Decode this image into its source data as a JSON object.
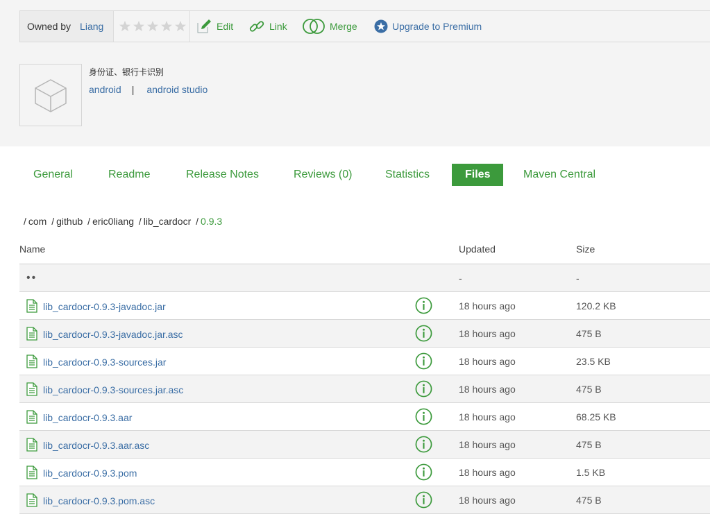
{
  "owner": {
    "label": "Owned by",
    "name": "Liang"
  },
  "rating": {
    "stars_filled": 0,
    "stars_total": 5
  },
  "toolbar": {
    "edit_label": "Edit",
    "link_label": "Link",
    "merge_label": "Merge",
    "upgrade_label": "Upgrade to Premium"
  },
  "package": {
    "description": "身份证、银行卡识别",
    "tags": [
      "android",
      "android studio"
    ],
    "tag_separator": "|"
  },
  "tabs": [
    {
      "label": "General",
      "active": false
    },
    {
      "label": "Readme",
      "active": false
    },
    {
      "label": "Release Notes",
      "active": false
    },
    {
      "label": "Reviews (0)",
      "active": false
    },
    {
      "label": "Statistics",
      "active": false
    },
    {
      "label": "Files",
      "active": true
    },
    {
      "label": "Maven Central",
      "active": false
    }
  ],
  "breadcrumb": {
    "segments": [
      "com",
      "github",
      "eric0liang",
      "lib_cardocr"
    ],
    "current": "0.9.3"
  },
  "table": {
    "headers": {
      "name": "Name",
      "updated": "Updated",
      "size": "Size"
    },
    "parent_row": {
      "name": "••",
      "updated": "-",
      "size": "-"
    },
    "files": [
      {
        "name": "lib_cardocr-0.9.3-javadoc.jar",
        "updated": "18 hours ago",
        "size": "120.2 KB"
      },
      {
        "name": "lib_cardocr-0.9.3-javadoc.jar.asc",
        "updated": "18 hours ago",
        "size": "475 B"
      },
      {
        "name": "lib_cardocr-0.9.3-sources.jar",
        "updated": "18 hours ago",
        "size": "23.5 KB"
      },
      {
        "name": "lib_cardocr-0.9.3-sources.jar.asc",
        "updated": "18 hours ago",
        "size": "475 B"
      },
      {
        "name": "lib_cardocr-0.9.3.aar",
        "updated": "18 hours ago",
        "size": "68.25 KB"
      },
      {
        "name": "lib_cardocr-0.9.3.aar.asc",
        "updated": "18 hours ago",
        "size": "475 B"
      },
      {
        "name": "lib_cardocr-0.9.3.pom",
        "updated": "18 hours ago",
        "size": "1.5 KB"
      },
      {
        "name": "lib_cardocr-0.9.3.pom.asc",
        "updated": "18 hours ago",
        "size": "475 B"
      }
    ]
  },
  "colors": {
    "accent_green": "#3c9a3c",
    "link_blue": "#3b6ea5",
    "band_gray": "#f4f4f4"
  },
  "icons": {
    "edit": "edit-pencil-icon",
    "link": "chain-link-icon",
    "merge": "merge-circles-icon",
    "upgrade": "star-badge-icon",
    "package": "package-box-icon",
    "file": "file-document-icon",
    "info": "info-circle-icon"
  }
}
